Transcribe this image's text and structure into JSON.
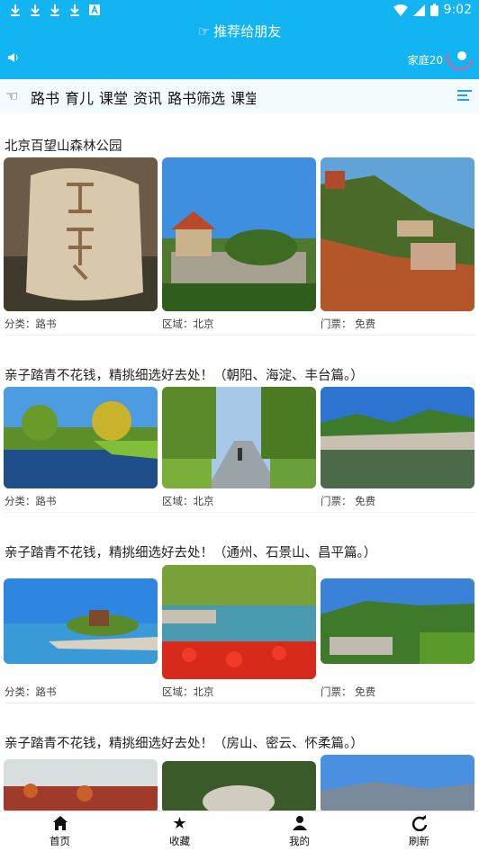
{
  "status_bar": {
    "time": "9:02"
  },
  "header": {
    "share_label": "推荐给朋友",
    "family_label": "家庭20",
    "icons": [
      "download-icon",
      "download-icon",
      "download-icon",
      "download-icon",
      "text-icon",
      "wifi-icon",
      "signal-icon",
      "battery-icon",
      "speaker-icon",
      "refresh-icon"
    ]
  },
  "tabs": {
    "items": [
      "路书",
      "育儿",
      "课堂",
      "资讯",
      "路书筛选",
      "课堂"
    ]
  },
  "articles": [
    {
      "title": "北京百望山森林公园",
      "meta": {
        "category": "分类：路书",
        "region": "区域：北京",
        "ticket": "门票： 免费"
      }
    },
    {
      "title": "亲子踏青不花钱，精挑细选好去处！（朝阳、海淀、丰台篇。）",
      "meta": {
        "category": "分类：路书",
        "region": "区域：北京",
        "ticket": "门票： 免费"
      }
    },
    {
      "title": "亲子踏青不花钱，精挑细选好去处！（通州、石景山、昌平篇。）",
      "meta": {
        "category": "分类：路书",
        "region": "区域：北京",
        "ticket": "门票： 免费"
      }
    },
    {
      "title": "亲子踏青不花钱，精挑细选好去处！（房山、密云、怀柔篇。）"
    }
  ],
  "bottom_nav": [
    {
      "label": "首页",
      "icon": "home-icon"
    },
    {
      "label": "收藏",
      "icon": "star-icon"
    },
    {
      "label": "我的",
      "icon": "user-icon"
    },
    {
      "label": "刷新",
      "icon": "refresh-icon"
    }
  ],
  "colors": {
    "header": "#12b5f2",
    "accent": "#1aa5e8",
    "ring": "#e55a9a"
  }
}
